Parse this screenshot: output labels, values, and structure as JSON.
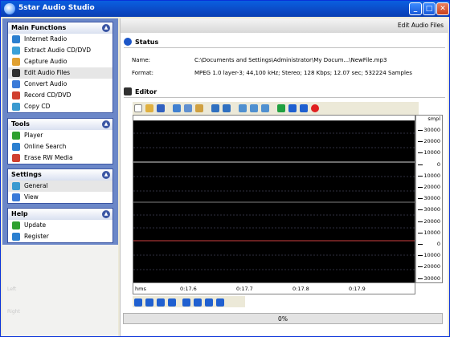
{
  "window": {
    "title": "5star Audio Studio"
  },
  "sidebar": {
    "main_functions": {
      "title": "Main Functions",
      "items": [
        {
          "label": "Internet Radio",
          "icon": "radio-icon",
          "color": "#2b7fd0"
        },
        {
          "label": "Extract Audio CD/DVD",
          "icon": "cd-extract-icon",
          "color": "#3aa0d8"
        },
        {
          "label": "Capture Audio",
          "icon": "capture-icon",
          "color": "#e0a030"
        },
        {
          "label": "Edit Audio Files",
          "icon": "edit-icon",
          "color": "#303030"
        },
        {
          "label": "Convert Audio",
          "icon": "convert-icon",
          "color": "#3a7ad8"
        },
        {
          "label": "Record CD/DVD",
          "icon": "record-cd-icon",
          "color": "#d04030"
        },
        {
          "label": "Copy CD",
          "icon": "copy-cd-icon",
          "color": "#3a9ad0"
        }
      ]
    },
    "tools": {
      "title": "Tools",
      "items": [
        {
          "label": "Player",
          "icon": "play-icon",
          "color": "#30a030"
        },
        {
          "label": "Online Search",
          "icon": "search-icon",
          "color": "#2b7fd0"
        },
        {
          "label": "Erase RW Media",
          "icon": "erase-icon",
          "color": "#d04030"
        }
      ]
    },
    "settings": {
      "title": "Settings",
      "items": [
        {
          "label": "General",
          "icon": "general-settings-icon",
          "color": "#3a9ad0"
        },
        {
          "label": "View",
          "icon": "view-icon",
          "color": "#3a7ad8"
        }
      ]
    },
    "help": {
      "title": "Help",
      "items": [
        {
          "label": "Update",
          "icon": "update-icon",
          "color": "#30a030"
        },
        {
          "label": "Register",
          "icon": "register-icon",
          "color": "#2b7fd0"
        }
      ]
    },
    "player_left_label": "Left",
    "player_right_label": "Right"
  },
  "main": {
    "tab_title": "Edit Audio Files",
    "status": {
      "title": "Status",
      "name_label": "Name:",
      "name_value": "C:\\Documents and Settings\\Administrator\\My Docum...\\NewFile.mp3",
      "format_label": "Format:",
      "format_value": "MPEG 1.0 layer-3; 44,100 kHz; Stereo; 128 Kbps; 12.07 sec; 532224 Samples"
    },
    "editor": {
      "title": "Editor",
      "scale_title": "smpl",
      "scale_labels": [
        "30000",
        "20000",
        "10000",
        "0",
        "10000",
        "20000",
        "30000",
        "30000",
        "20000",
        "10000",
        "0",
        "10000",
        "20000",
        "30000"
      ],
      "timeline_unit": "hms",
      "timeline_labels": [
        "0:17.6",
        "0:17.7",
        "0:17.8",
        "0:17.9"
      ]
    },
    "progress": {
      "value": 0,
      "label": "0%"
    }
  },
  "colors": {
    "titlebar": "#0a5fdf",
    "sidebar": "#6b87c8",
    "waveform_bg": "#000000",
    "channel_line": "#d04040"
  }
}
